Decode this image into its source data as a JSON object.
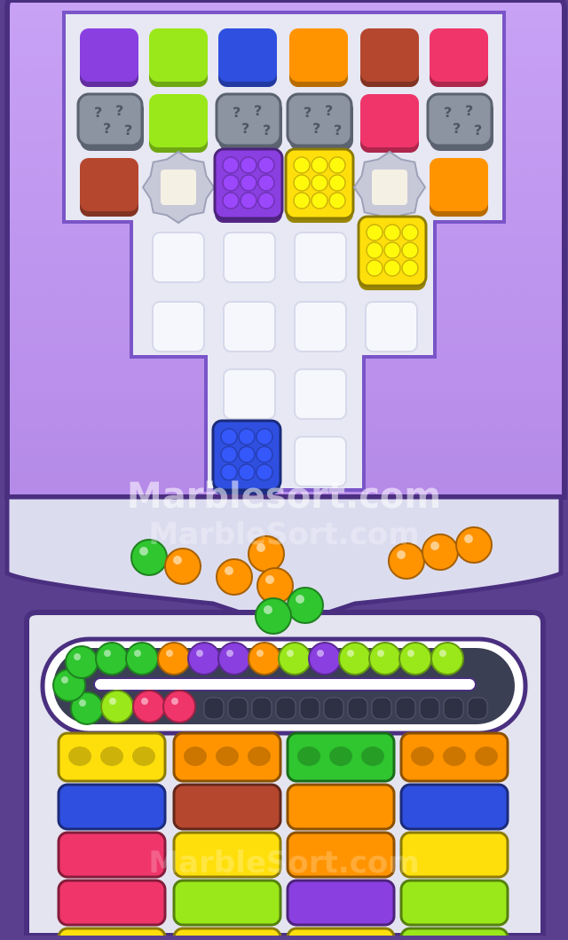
{
  "watermark": {
    "primary": "Marblesort.com",
    "secondary": "MarbleSort.com",
    "bottom": "MarbleSort.com"
  },
  "colors": {
    "purple": "#8a3fe0",
    "lime": "#9ae81a",
    "blue": "#2f4fe0",
    "orange": "#ff9400",
    "brown": "#b5472f",
    "pink": "#f0356a",
    "yellow": "#ffdf0b",
    "green": "#2fc62f",
    "gray": "#8b94a0"
  },
  "board": {
    "rows": [
      [
        "purple",
        "lime",
        "blue",
        "orange",
        "brown",
        "pink"
      ],
      [
        "mystery",
        "lime",
        "mystery",
        "mystery",
        "pink",
        "mystery"
      ],
      [
        "brown",
        "empty-frame",
        "purple-box",
        "yellow-box",
        "empty-frame",
        "orange"
      ]
    ],
    "placed_boxes": [
      "yellow-box",
      "blue-box"
    ]
  },
  "loose_marbles": [
    "green",
    "orange",
    "orange",
    "orange",
    "orange",
    "green",
    "green",
    "orange",
    "orange",
    "orange"
  ],
  "conveyor": {
    "marbles": [
      "green",
      "green",
      "green",
      "green",
      "green",
      "orange",
      "purple",
      "purple",
      "orange",
      "lime",
      "purple",
      "lime",
      "lime",
      "lime",
      "lime",
      "lime",
      "pink",
      "pink",
      "pink"
    ],
    "empty_slots": 13
  },
  "columns": [
    [
      "yellow",
      "blue",
      "pink",
      "pink",
      "yellow"
    ],
    [
      "orange",
      "brown",
      "yellow",
      "lime",
      "yellow"
    ],
    [
      "green",
      "orange",
      "orange",
      "purple",
      "yellow"
    ],
    [
      "orange",
      "blue",
      "yellow",
      "lime",
      "lime"
    ]
  ],
  "column_tops": [
    [
      "yellow",
      "yellow",
      "yellow"
    ],
    [
      "orange",
      "orange",
      "orange"
    ],
    [
      "green",
      "green",
      "green"
    ],
    [
      "orange",
      "orange",
      "orange"
    ]
  ]
}
